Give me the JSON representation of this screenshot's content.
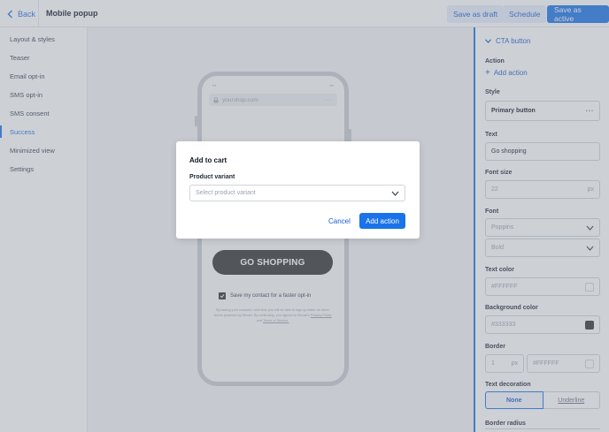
{
  "topbar": {
    "back_label": "Back",
    "title": "Mobile popup",
    "save_draft_label": "Save as draft",
    "schedule_label": "Schedule",
    "save_active_label": "Save as active"
  },
  "nav": {
    "items": [
      {
        "label": "Layout & styles"
      },
      {
        "label": "Teaser"
      },
      {
        "label": "Email opt-in"
      },
      {
        "label": "SMS opt-in"
      },
      {
        "label": "SMS consent"
      },
      {
        "label": "Success",
        "active": true
      },
      {
        "label": "Minimized view"
      },
      {
        "label": "Settings"
      }
    ]
  },
  "preview": {
    "url": "yourshop.com",
    "cta_label": "GO SHOPPING",
    "optin_label": "Save my contact for a faster opt-in",
    "legal_text": "By saving your contacts, next time you will be able to sign up faster on other stores powered by Recart. By continuing, you agreed to Recart's",
    "legal_privacy": "Privacy Policy",
    "legal_and": "and",
    "legal_terms": "Terms of Service."
  },
  "panel": {
    "section_title": "CTA button",
    "action_label": "Action",
    "add_action_label": "Add action",
    "style_label": "Style",
    "style_value": "Primary button",
    "text_label": "Text",
    "text_value": "Go shopping",
    "font_size_label": "Font size",
    "font_size_value": "22",
    "font_size_unit": "px",
    "font_label": "Font",
    "font_value": "Poppins",
    "font_weight_value": "Bold",
    "text_color_label": "Text color",
    "text_color_value": "#FFFFFF",
    "bg_color_label": "Background color",
    "bg_color_value": "#333333",
    "border_label": "Border",
    "border_width_value": "1",
    "border_width_unit": "px",
    "border_color_value": "#FFFFFF",
    "text_decoration_label": "Text decoration",
    "decoration_none": "None",
    "decoration_underline": "Underline",
    "border_radius_label": "Border radius"
  },
  "modal": {
    "title": "Add to cart",
    "field_label": "Product variant",
    "select_placeholder": "Select product variant",
    "cancel_label": "Cancel",
    "add_label": "Add action"
  },
  "colors": {
    "accent": "#1a73e8",
    "cta_bg": "#333333",
    "cta_text": "#FFFFFF"
  }
}
